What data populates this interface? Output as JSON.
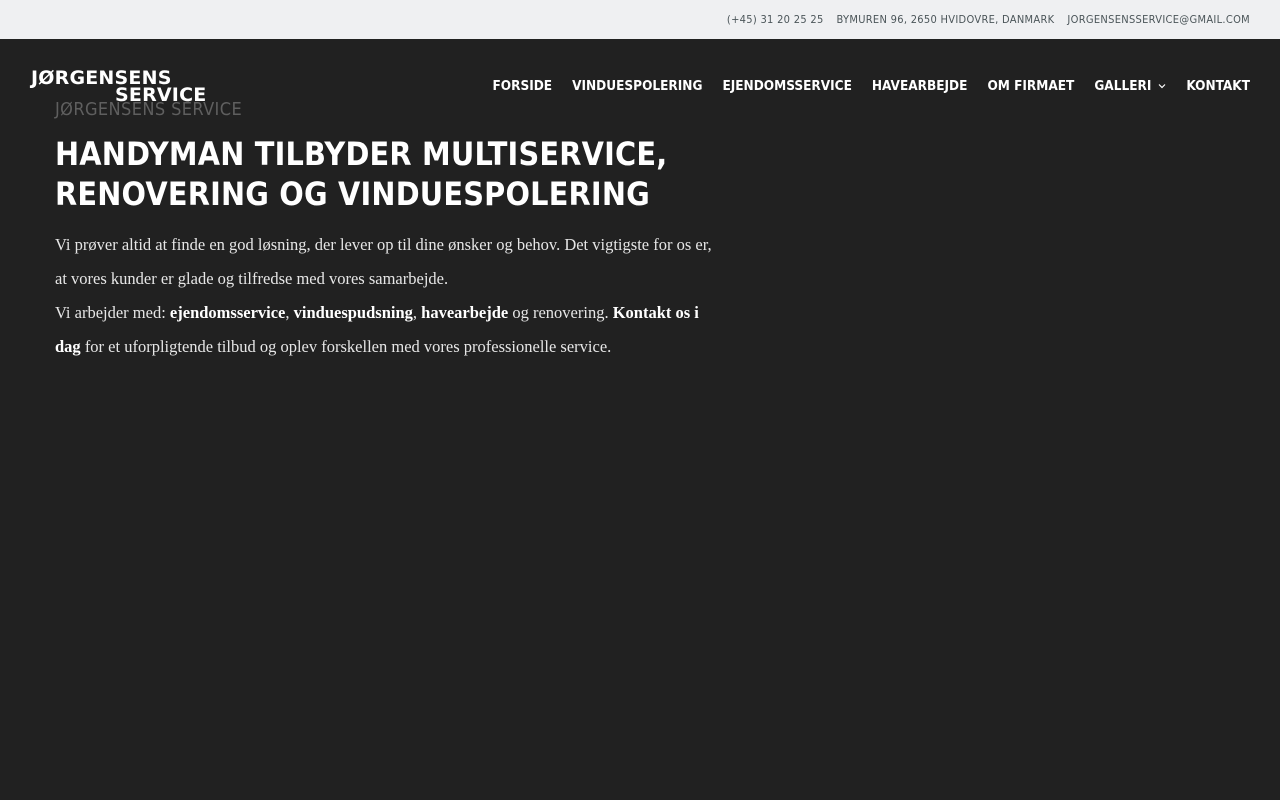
{
  "topbar": {
    "phone": "(+45) 31 20 25 25",
    "address": "BYMUREN 96, 2650 HVIDOVRE, DANMARK",
    "email": "JORGENSENSSERVICE@GMAIL.COM"
  },
  "logo": {
    "line1": "JØRGENSENS",
    "line2": "SERVICE"
  },
  "nav": {
    "items": [
      {
        "label": "FORSIDE"
      },
      {
        "label": "VINDUESPOLERING"
      },
      {
        "label": "EJENDOMSSERVICE"
      },
      {
        "label": "HAVEARBEJDE"
      },
      {
        "label": "OM FIRMAET"
      },
      {
        "label": "GALLERI",
        "icon": "chevron-down-icon"
      },
      {
        "label": "KONTAKT"
      }
    ]
  },
  "hero": {
    "eyebrow": "JØRGENSENS SERVICE",
    "title": "HANDYMAN TILBYDER MULTISERVICE, RENOVERING OG VINDUESPOLERING",
    "paragraph1": "Vi prøver altid at finde en god løsning, der lever op til dine ønsker og behov. Det vigtigste for os er, at vores kunder er glade og tilfredse med vores samarbejde.",
    "p2_prefix": "Vi arbejder med: ",
    "p2_link1": "ejendomsservice",
    "p2_sep1": ", ",
    "p2_link2": "vinduespudsning",
    "p2_sep2": ", ",
    "p2_link3": "havearbejde",
    "p2_mid": " og renovering. ",
    "p2_link4": "Kontakt os i dag",
    "p2_suffix": " for et uforpligtende tilbud og oplev forskellen med vores professionelle service."
  },
  "colors": {
    "background": "#212121",
    "topbar_bg": "#eff0f2",
    "topbar_text": "#4b5559",
    "eyebrow": "#5f5f5f",
    "text": "#ffffff"
  }
}
